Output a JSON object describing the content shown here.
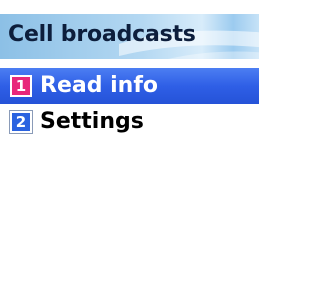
{
  "header": {
    "title": "Cell broadcasts"
  },
  "menu": {
    "items": [
      {
        "number": "1",
        "label": "Read info",
        "selected": true,
        "badge_color": "#e8287a"
      },
      {
        "number": "2",
        "label": "Settings",
        "selected": false,
        "badge_color": "#2b63e0"
      }
    ]
  },
  "colors": {
    "highlight": "#2f5fe6",
    "title_bar": "#b4d8f2",
    "background": "#ffffff"
  }
}
